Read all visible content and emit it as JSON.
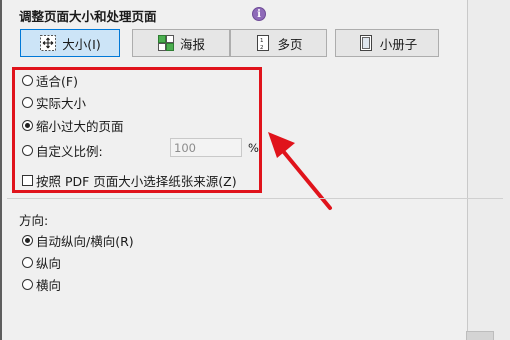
{
  "section": {
    "title": "调整页面大小和处理页面"
  },
  "tabs": [
    {
      "label": "大小(I)",
      "icon": "resize-icon",
      "active": true
    },
    {
      "label": "海报",
      "icon": "poster-icon",
      "active": false
    },
    {
      "label": "多页",
      "icon": "multiple-pages-icon",
      "active": false
    },
    {
      "label": "小册子",
      "icon": "booklet-icon",
      "active": false
    }
  ],
  "size_options": {
    "fit": "适合(F)",
    "actual": "实际大小",
    "shrink": "缩小过大的页面",
    "custom": "自定义比例:",
    "selected": "shrink",
    "custom_scale_value": "100",
    "percent_unit": "%",
    "paper_source": "按照 PDF 页面大小选择纸张来源(Z)",
    "paper_source_checked": false
  },
  "orientation": {
    "label": "方向:",
    "options": [
      "自动纵向/横向(R)",
      "纵向",
      "横向"
    ],
    "selected": 0
  },
  "colors": {
    "highlight": "#e0131b",
    "active_tab_bg": "#cce4f7",
    "active_tab_border": "#0078d7"
  }
}
